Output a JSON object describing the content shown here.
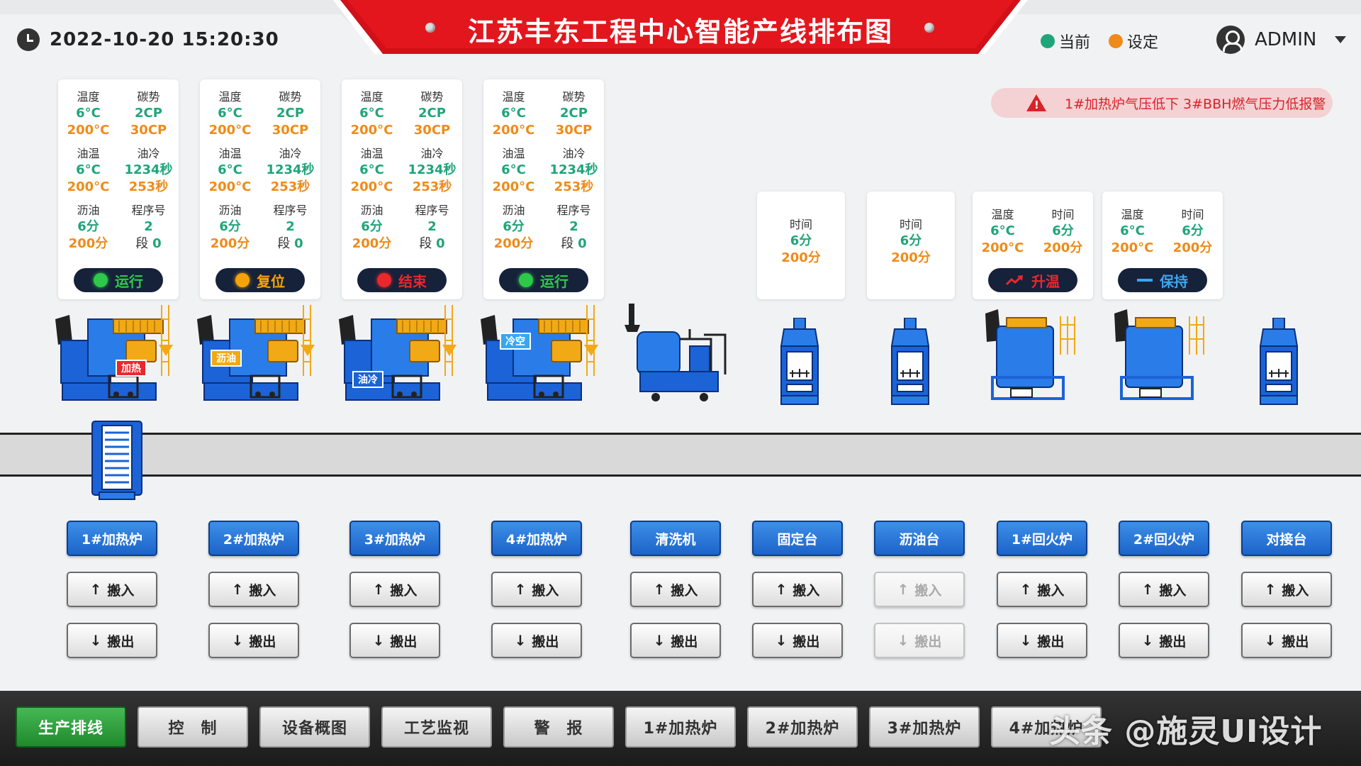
{
  "header": {
    "datetime": "2022-10-20 15:20:30",
    "title": "江苏丰东工程中心智能产线排布图",
    "legend": [
      {
        "label": "当前",
        "color": "#1fa57a"
      },
      {
        "label": "设定",
        "color": "#ee8b1a"
      }
    ],
    "user": "ADMIN"
  },
  "alarm": {
    "text": "1#加热炉气压低下 3#BBH燃气压力低报警",
    "color": "#d8232a"
  },
  "furnace_cards": [
    {
      "temp_label": "温度",
      "temp_cur": "6°C",
      "temp_set": "200°C",
      "carbon_label": "碳势",
      "carbon_cur": "2CP",
      "carbon_set": "30CP",
      "oil_temp_label": "油温",
      "oil_temp_cur": "6°C",
      "oil_temp_set": "200°C",
      "oil_cool_label": "油冷",
      "oil_cool_cur": "1234秒",
      "oil_cool_set": "253秒",
      "drain_label": "沥油",
      "drain_cur": "6分",
      "drain_set": "200分",
      "prog_label": "程序号",
      "prog_cur": "2",
      "seg_label": "段",
      "seg_val": "0",
      "status": "运行",
      "status_color": "#2ec84a",
      "status_text_color": "#2ec84a"
    },
    {
      "temp_label": "温度",
      "temp_cur": "6°C",
      "temp_set": "200°C",
      "carbon_label": "碳势",
      "carbon_cur": "2CP",
      "carbon_set": "30CP",
      "oil_temp_label": "油温",
      "oil_temp_cur": "6°C",
      "oil_temp_set": "200°C",
      "oil_cool_label": "油冷",
      "oil_cool_cur": "1234秒",
      "oil_cool_set": "253秒",
      "drain_label": "沥油",
      "drain_cur": "6分",
      "drain_set": "200分",
      "prog_label": "程序号",
      "prog_cur": "2",
      "seg_label": "段",
      "seg_val": "0",
      "status": "复位",
      "status_color": "#f5a30a",
      "status_text_color": "#f5a30a"
    },
    {
      "temp_label": "温度",
      "temp_cur": "6°C",
      "temp_set": "200°C",
      "carbon_label": "碳势",
      "carbon_cur": "2CP",
      "carbon_set": "30CP",
      "oil_temp_label": "油温",
      "oil_temp_cur": "6°C",
      "oil_temp_set": "200°C",
      "oil_cool_label": "油冷",
      "oil_cool_cur": "1234秒",
      "oil_cool_set": "253秒",
      "drain_label": "沥油",
      "drain_cur": "6分",
      "drain_set": "200分",
      "prog_label": "程序号",
      "prog_cur": "2",
      "seg_label": "段",
      "seg_val": "0",
      "status": "结束",
      "status_color": "#e8282d",
      "status_text_color": "#e8282d"
    },
    {
      "temp_label": "温度",
      "temp_cur": "6°C",
      "temp_set": "200°C",
      "carbon_label": "碳势",
      "carbon_cur": "2CP",
      "carbon_set": "30CP",
      "oil_temp_label": "油温",
      "oil_temp_cur": "6°C",
      "oil_temp_set": "200°C",
      "oil_cool_label": "油冷",
      "oil_cool_cur": "1234秒",
      "oil_cool_set": "253秒",
      "drain_label": "沥油",
      "drain_cur": "6分",
      "drain_set": "200分",
      "prog_label": "程序号",
      "prog_cur": "2",
      "seg_label": "段",
      "seg_val": "0",
      "status": "运行",
      "status_color": "#2ec84a",
      "status_text_color": "#2ec84a"
    }
  ],
  "time_cards": [
    {
      "label": "时间",
      "cur": "6分",
      "set": "200分"
    },
    {
      "label": "时间",
      "cur": "6分",
      "set": "200分"
    }
  ],
  "temper_cards": [
    {
      "temp_label": "温度",
      "temp_cur": "6°C",
      "temp_set": "200°C",
      "time_label": "时间",
      "time_cur": "6分",
      "time_set": "200分",
      "status": "升温",
      "status_color": "#e8282d"
    },
    {
      "temp_label": "温度",
      "temp_cur": "6°C",
      "temp_set": "200°C",
      "time_label": "时间",
      "time_cur": "6分",
      "time_set": "200分",
      "status": "保持",
      "status_color": "#3aa6f0"
    }
  ],
  "machine_labels": [
    "加热",
    "沥油",
    "油冷",
    "冷空"
  ],
  "stations": [
    {
      "name": "1#加热炉",
      "in": "搬入",
      "out": "搬出",
      "enabled": true
    },
    {
      "name": "2#加热炉",
      "in": "搬入",
      "out": "搬出",
      "enabled": true
    },
    {
      "name": "3#加热炉",
      "in": "搬入",
      "out": "搬出",
      "enabled": true
    },
    {
      "name": "4#加热炉",
      "in": "搬入",
      "out": "搬出",
      "enabled": true
    },
    {
      "name": "清洗机",
      "in": "搬入",
      "out": "搬出",
      "enabled": true
    },
    {
      "name": "固定台",
      "in": "搬入",
      "out": "搬出",
      "enabled": true
    },
    {
      "name": "沥油台",
      "in": "搬入",
      "out": "搬出",
      "enabled": false
    },
    {
      "name": "1#回火炉",
      "in": "搬入",
      "out": "搬出",
      "enabled": true
    },
    {
      "name": "2#回火炉",
      "in": "搬入",
      "out": "搬出",
      "enabled": true
    },
    {
      "name": "对接台",
      "in": "搬入",
      "out": "搬出",
      "enabled": true
    }
  ],
  "bottom_nav": [
    "生产排线",
    "控　制",
    "设备概图",
    "工艺监视",
    "警　报",
    "1#加热炉",
    "2#加热炉",
    "3#加热炉",
    "4#加热炉"
  ],
  "watermark": "头条 @施灵UI设计"
}
